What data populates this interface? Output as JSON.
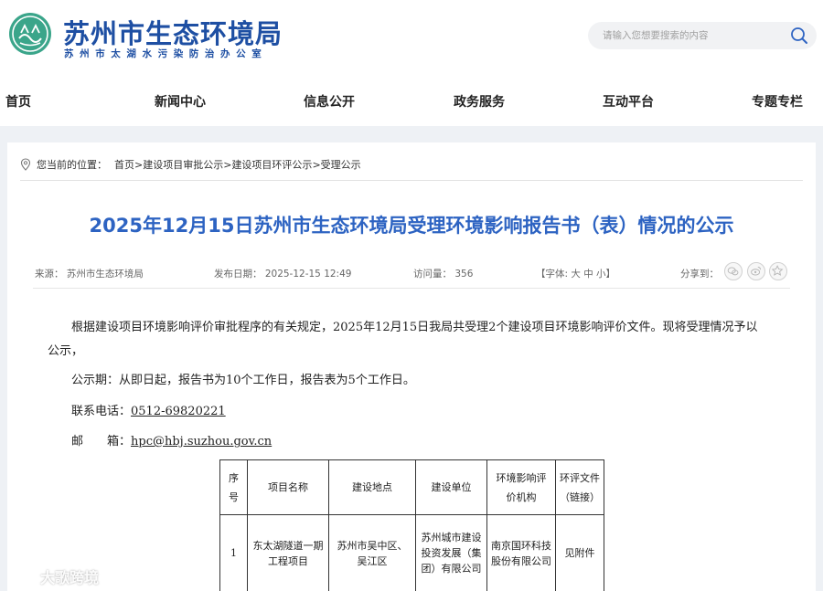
{
  "header": {
    "title": "苏州市生态环境局",
    "subtitle": "苏州市太湖水污染防治办公室",
    "search_placeholder": "请输入您想要搜索的内容"
  },
  "nav": {
    "items": [
      {
        "label": "首页"
      },
      {
        "label": "新闻中心"
      },
      {
        "label": "信息公开"
      },
      {
        "label": "政务服务"
      },
      {
        "label": "互动平台"
      },
      {
        "label": "专题专栏"
      }
    ]
  },
  "breadcrumb": {
    "prefix": "您当前的位置：",
    "items": [
      "首页",
      "建设项目审批公示",
      "建设项目环评公示",
      "受理公示"
    ],
    "sep": " > "
  },
  "article": {
    "title": "2025年12月15日苏州市生态环境局受理环境影响报告书（表）情况的公示",
    "source": "来源：  苏州市生态环境局",
    "date": "发布日期：  2025-12-15 12:49",
    "visits": "访问量：  356",
    "font": "【字体: 大 中 小】",
    "share": "分享到：",
    "para1_line1": "根据建设项目环境影响评价审批程序的有关规定，2025年12月15日我局共受理2个建设项目环境影响评价文件。现将受理情况予以",
    "para1_line2": "公示，",
    "para2": "公示期：从即日起，报告书为10个工作日，报告表为5个工作日。",
    "phone_label": "联系电话：",
    "phone": "0512-69820221",
    "email_label": "邮　　箱：",
    "email": "hpc@hbj.suzhou.gov.cn"
  },
  "table": {
    "headers": [
      "序号",
      "项目名称",
      "建设地点",
      "建设单位",
      "环境影响评价机构",
      "环评文件（链接）"
    ],
    "rows": [
      {
        "no": "1",
        "name": "东太湖隧道一期工程项目",
        "location": "苏州市吴中区、吴江区",
        "builder": "苏州城市建设投资发展（集团）有限公司",
        "agency": "南京国环科技股份有限公司",
        "file": "见附件"
      }
    ]
  },
  "watermark": "大歌跨境",
  "colors": {
    "brand_blue": "#1e4fa3",
    "title_blue": "#2d63c2",
    "content_bg": "#eef1f5"
  }
}
